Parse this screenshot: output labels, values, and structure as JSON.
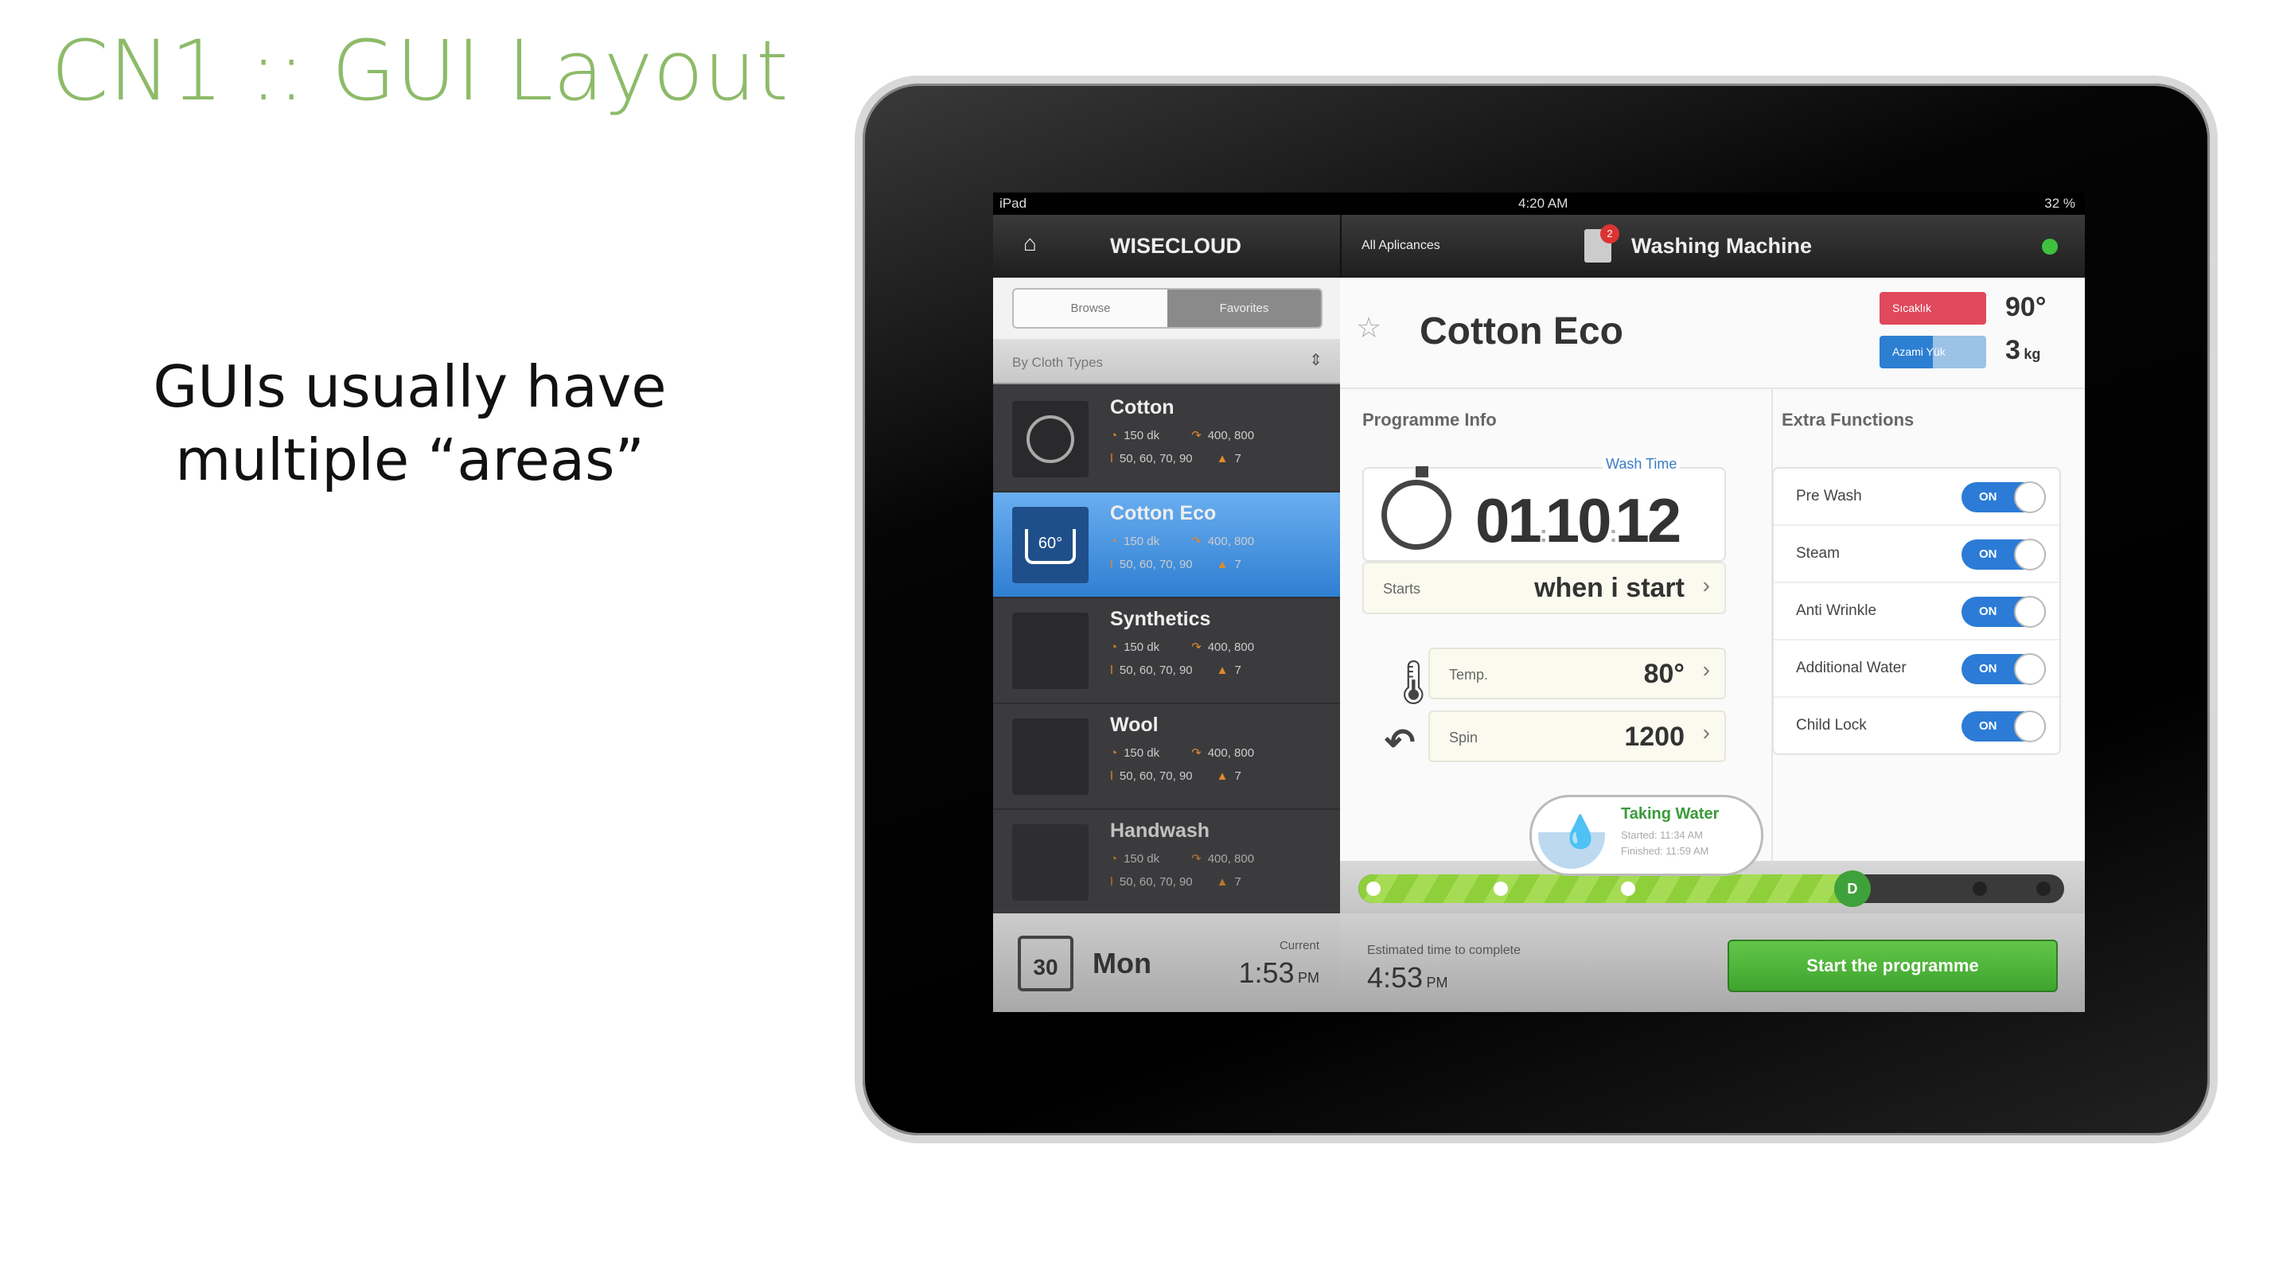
{
  "slide": {
    "title": "CN1 :: GUI Layout",
    "body_line1": "GUIs usually have",
    "body_line2": "multiple “areas”",
    "title_color": "#8dbb69"
  },
  "statusbar": {
    "carrier": "iPad",
    "time": "4:20 AM",
    "battery": "32 %"
  },
  "navbar": {
    "app_name": "WISECLOUD",
    "back_label": "All Aplicances",
    "title": "Washing Machine",
    "badge_count": "2",
    "status_color": "#3fc13f",
    "home_icon": "home-icon"
  },
  "sidebar": {
    "segments": [
      "Browse",
      "Favorites"
    ],
    "active_segment": "Favorites",
    "filter": "By Cloth Types",
    "items": [
      {
        "name": "Cotton",
        "duration": "150 dk",
        "spin": "400, 800",
        "temps": "50, 60, 70, 90",
        "load": "7",
        "selected": false
      },
      {
        "name": "Cotton Eco",
        "duration": "150 dk",
        "spin": "400, 800",
        "temps": "50, 60, 70, 90",
        "load": "7",
        "selected": true
      },
      {
        "name": "Synthetics",
        "duration": "150 dk",
        "spin": "400, 800",
        "temps": "50, 60, 70, 90",
        "load": "7",
        "selected": false
      },
      {
        "name": "Wool",
        "duration": "150 dk",
        "spin": "400, 800",
        "temps": "50, 60, 70, 90",
        "load": "7",
        "selected": false
      },
      {
        "name": "Handwash",
        "duration": "150 dk",
        "spin": "400, 800",
        "temps": "50, 60, 70, 90",
        "load": "7",
        "selected": false
      }
    ],
    "footer": {
      "day_number": "30",
      "day": "Mon",
      "current_label": "Current",
      "current_time": "1:53",
      "current_ampm": "PM"
    }
  },
  "program": {
    "title": "Cotton Eco",
    "badge_red": "Sıcaklık",
    "badge_blue": "Azami Yük",
    "temp_max": "90°",
    "load_max": "3",
    "load_unit": "kg",
    "info_label": "Programme Info",
    "wash_time_label": "Wash Time",
    "wash_time": {
      "h": "01",
      "m": "10",
      "s": "12"
    },
    "starts_label": "Starts",
    "starts_value": "when i start",
    "temp_label": "Temp.",
    "temp_value": "80°",
    "spin_label": "Spin",
    "spin_value": "1200"
  },
  "extra": {
    "label": "Extra Functions",
    "items": [
      {
        "name": "Pre Wash",
        "state": "ON"
      },
      {
        "name": "Steam",
        "state": "ON"
      },
      {
        "name": "Anti Wrinkle",
        "state": "ON"
      },
      {
        "name": "Additional Water",
        "state": "ON"
      },
      {
        "name": "Child Lock",
        "state": "ON"
      }
    ]
  },
  "progress": {
    "percent": 70,
    "current_marker": "D",
    "bubble_title": "Taking Water",
    "bubble_started": "Started: 11:34 AM",
    "bubble_finished": "Finished: 11:59 AM"
  },
  "footer": {
    "estimate_label": "Estimated time to complete",
    "estimate_time": "4:53",
    "estimate_ampm": "PM",
    "start_button": "Start the programme"
  }
}
